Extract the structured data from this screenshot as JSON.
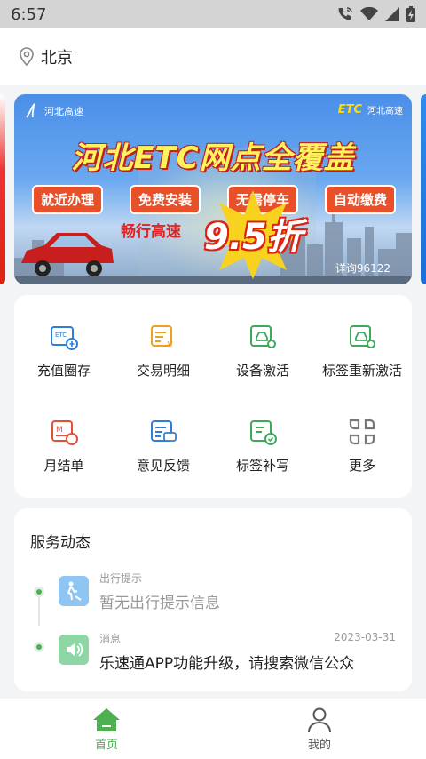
{
  "status_bar": {
    "time": "6:57",
    "icons": [
      "call-wifi-icon",
      "wifi-icon",
      "signal-icon",
      "battery-icon"
    ]
  },
  "location": {
    "city": "北京",
    "icon": "location-pin-icon"
  },
  "banner": {
    "logo_left": "河北高速",
    "logo_right": "ETC",
    "logo_right_sub": "河北高速",
    "headline": "河北ETC网点全覆盖",
    "tags": [
      "就近办理",
      "免费安装",
      "无需停车",
      "自动缴费"
    ],
    "promo": "畅行高速",
    "discount": "9.5折",
    "hotline": "详询96122"
  },
  "services": [
    {
      "label": "充值圈存",
      "icon": "etc-card-recharge-icon",
      "color": "#2f7fd8"
    },
    {
      "label": "交易明细",
      "icon": "transaction-detail-icon",
      "color": "#f0a020"
    },
    {
      "label": "设备激活",
      "icon": "device-activate-icon",
      "color": "#3caa5a"
    },
    {
      "label": "标签重新激活",
      "icon": "tag-reactivate-icon",
      "color": "#3caa5a"
    },
    {
      "label": "月结单",
      "icon": "monthly-statement-icon",
      "color": "#e0503a"
    },
    {
      "label": "意见反馈",
      "icon": "feedback-icon",
      "color": "#2f7fd8"
    },
    {
      "label": "标签补写",
      "icon": "tag-rewrite-icon",
      "color": "#3caa5a"
    },
    {
      "label": "更多",
      "icon": "more-grid-icon",
      "color": "#777777"
    }
  ],
  "service_news": {
    "title": "服务动态",
    "items": [
      {
        "category": "出行提示",
        "text": "暂无出行提示信息",
        "date": "",
        "icon": "road-work-icon",
        "icon_bg": "#8ec5f2",
        "muted": true
      },
      {
        "category": "消息",
        "text": "乐速通APP功能升级，请搜索微信公众",
        "date": "2023-03-31",
        "icon": "speaker-icon",
        "icon_bg": "#8fd6a6",
        "muted": false
      }
    ]
  },
  "tabbar": {
    "tabs": [
      {
        "label": "首页",
        "icon": "home-icon",
        "active": true
      },
      {
        "label": "我的",
        "icon": "user-icon",
        "active": false
      }
    ],
    "active_color": "#4caf50"
  }
}
